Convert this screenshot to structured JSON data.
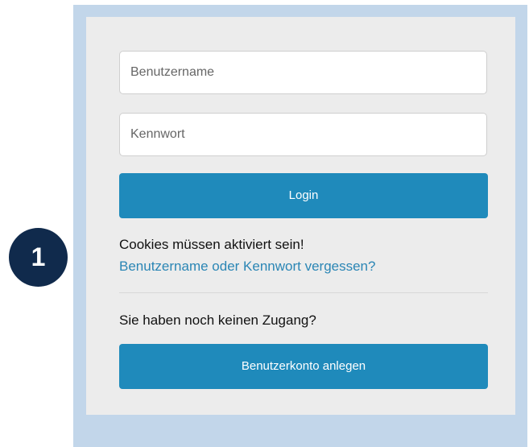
{
  "form": {
    "username_placeholder": "Benutzername",
    "password_placeholder": "Kennwort",
    "login_label": "Login",
    "cookies_notice": "Cookies müssen aktiviert sein!",
    "forgot_link": "Benutzername oder Kennwort vergessen?",
    "no_account_text": "Sie haben noch keinen Zugang?",
    "register_label": "Benutzerkonto anlegen"
  },
  "annotation": {
    "badge_number": "1"
  },
  "colors": {
    "frame": "#c2d6ea",
    "panel": "#ececec",
    "button": "#1f8abb",
    "link": "#2b86b5",
    "badge": "#102a4c"
  }
}
